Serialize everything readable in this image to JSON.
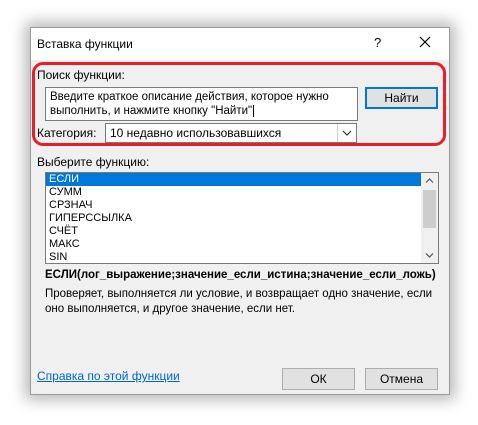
{
  "dialog": {
    "title": "Вставка функции",
    "help_glyph": "?",
    "close_glyph": "✕"
  },
  "search": {
    "label": "Поиск функции:",
    "value_line1": "Введите краткое описание действия, которое нужно",
    "value_line2": "выполнить, и нажмите кнопку \"Найти\"",
    "find_button": "Найти"
  },
  "category": {
    "label": "Категория:",
    "selected": "10 недавно использовавшихся"
  },
  "function_list": {
    "label": "Выберите функцию:",
    "items": [
      "ЕСЛИ",
      "СУММ",
      "СРЗНАЧ",
      "ГИПЕРССЫЛКА",
      "СЧЁТ",
      "МАКС",
      "SIN"
    ],
    "selected_index": 0
  },
  "selected_function": {
    "syntax": "ЕСЛИ(лог_выражение;значение_если_истина;значение_если_ложь)",
    "description": "Проверяет, выполняется ли условие, и возвращает одно значение, если оно выполняется, и другое значение, если нет."
  },
  "footer": {
    "help_link": "Справка по этой функции",
    "ok_button": "ОК",
    "cancel_button": "Отмена"
  },
  "colors": {
    "highlight": "#e81e2a",
    "selection": "#0078d7",
    "link": "#0066cc"
  }
}
